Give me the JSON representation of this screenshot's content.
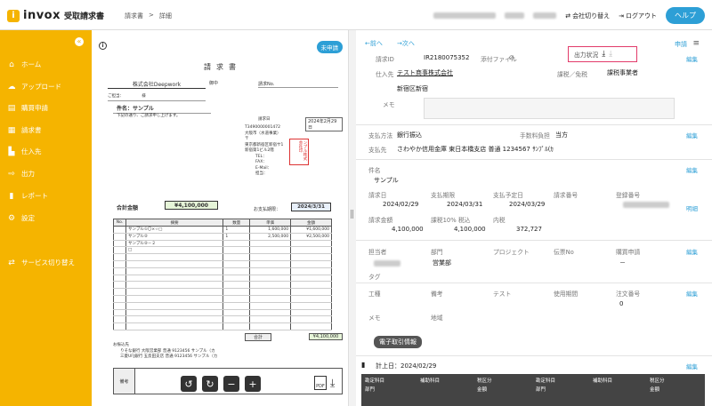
{
  "app": {
    "logo_mark": "i",
    "name": "invox",
    "subtitle": "受取請求書"
  },
  "breadcrumb": {
    "root": "請求書",
    "sep": ">",
    "current": "詳細"
  },
  "header": {
    "switch_company": "会社切り替え",
    "logout": "ログアウト",
    "help": "ヘルプ"
  },
  "sidebar": {
    "toggle": "«",
    "items": [
      {
        "label": "ホーム",
        "icon": "⌂"
      },
      {
        "label": "アップロード",
        "icon": "☁"
      },
      {
        "label": "購買申請",
        "icon": "▤"
      },
      {
        "label": "請求書",
        "icon": "▦"
      },
      {
        "label": "仕入先",
        "icon": "▙"
      },
      {
        "label": "出力",
        "icon": "⇨"
      },
      {
        "label": "レポート",
        "icon": "▮"
      },
      {
        "label": "設定",
        "icon": "⚙"
      },
      {
        "label": "サービス切り替え",
        "icon": "⇄"
      }
    ]
  },
  "viewer": {
    "status_badge": "未申請",
    "info": "i",
    "doc": {
      "title": "請求書",
      "to_company": "株式会社Deepwork",
      "to_suffix": "御中",
      "invoice_no_label": "請求No.",
      "attention": "ご担当：　　　　　様",
      "subject": "件名：サンプル",
      "intro": "下記の通り、ご請求申し上げます。",
      "issue_label": "請求日",
      "issue_date": "2024年2月29日",
      "issuer_lines": [
        "T3490000001472",
        "大阪市（水道事業）",
        "〒",
        "東京都新宿区新宿サ1",
        "新宿第1ビル2階",
        "TEL：",
        "FAX：",
        "E-Mail：",
        "担当："
      ],
      "seal_text": "ンプル株式会社印",
      "total_label": "合計金額",
      "total": "¥4,100,000",
      "pay_label": "お支払期限：",
      "pay_date": "2024/3/31",
      "headers": [
        "No.",
        "摘要",
        "数量",
        "単価",
        "金額"
      ],
      "rows": [
        {
          "no": "",
          "desc": "サンプル①〇×☆□",
          "qty": "1",
          "price": "1,600,000",
          "amount": "¥1,600,000"
        },
        {
          "no": "",
          "desc": "サンプル②",
          "qty": "1",
          "price": "2,500,000",
          "amount": "¥2,500,000"
        },
        {
          "no": "",
          "desc": "サンプル②－２",
          "qty": "",
          "price": "",
          "amount": ""
        },
        {
          "no": "",
          "desc": "□",
          "qty": "",
          "price": "",
          "amount": ""
        }
      ],
      "sum_label": "合計",
      "sum": "¥4,100,000",
      "bank_label": "お振込先",
      "bank_lines": [
        "りそな銀行 大阪営業部 普通 9123456 サンプル（カ",
        "三菱UFJ銀行 五反田支店 普通 9123456 サンプル（カ"
      ],
      "remarks_label": "備考"
    },
    "tools": {
      "rotate_left": "↺",
      "rotate_right": "↻",
      "zoom_out": "−",
      "zoom_in": "+",
      "pdf": "PDF",
      "download": "⤓"
    }
  },
  "detail": {
    "prev": "←前へ",
    "next": "→次へ",
    "apply": "申請",
    "menu": "≡",
    "request_id_label": "請求ID",
    "request_id": "IR2180075352",
    "attach_label": "添付ファイル",
    "attach_icon": "⌀",
    "output_label": "出力状況",
    "output_icon_1": "⤓",
    "output_icon_2": "⤓",
    "edit": "編集",
    "supplier_label": "仕入先",
    "supplier": "テスト商事株式会社",
    "supplier_addr": "新宿区新宿",
    "tax_label": "課税／免税",
    "tax_value": "課税事業者",
    "memo_label": "メモ",
    "pay_method_label": "支払方法",
    "pay_method": "銀行振込",
    "fee_label": "手数料負担",
    "fee": "当方",
    "payee_label": "支払先",
    "payee": "さわやか信用金庫 東日本橋支店 普通 1234567 ｻﾝﾌﾟﾙ(ｶ",
    "subject_label": "件名",
    "subject": "サンプル",
    "invoice_date_label": "請求日",
    "invoice_date": "2024/02/29",
    "due_label": "支払期限",
    "due": "2024/03/31",
    "plan_label": "支払予定日",
    "plan": "2024/03/29",
    "invoice_no_label": "請求番号",
    "reg_no_label": "登録番号",
    "detail_link": "明細",
    "amount_label": "請求金額",
    "amount": "4,100,000",
    "taxable_label": "課税10% 税込",
    "taxable": "4,100,000",
    "incl_label": "内税",
    "incl": "372,727",
    "person_label": "担当者",
    "dept_label": "部門",
    "dept": "営業部",
    "project_label": "プロジェクト",
    "slip_label": "伝票No",
    "purchase_label": "購買申請",
    "purchase": "－",
    "tag_label": "タグ",
    "work_label": "工種",
    "note_label": "備考",
    "test_label": "テスト",
    "period_label": "使用期間",
    "order_label": "注文番号",
    "order": "0",
    "memo2_label": "メモ",
    "area_label": "地域",
    "edi_button": "電子取引情報",
    "book_label": "計上日：2024/02/29",
    "acct_headers": [
      "勘定科目",
      "補助科目",
      "税区分",
      "勘定科目",
      "補助科目",
      "税区分"
    ],
    "acct_headers2": [
      "部門",
      "金額",
      "部門",
      "金額"
    ]
  }
}
